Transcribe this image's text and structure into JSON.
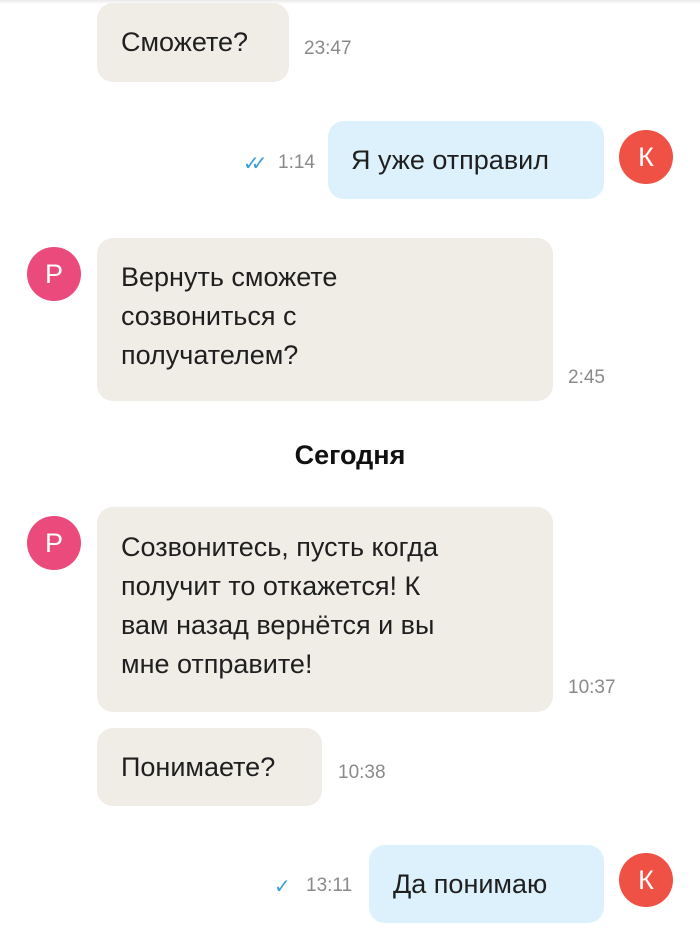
{
  "day_separator": "Сегодня",
  "colors": {
    "avatar_p": "#ea4b7c",
    "avatar_k": "#ef5145",
    "incoming_bubble": "#f0ede7",
    "outgoing_bubble": "#dcf1fc",
    "check": "#3a9fd8"
  },
  "messages": [
    {
      "direction": "incoming",
      "text": "Сможете?",
      "time": "23:47"
    },
    {
      "direction": "outgoing",
      "text": "Я уже отправил",
      "time": "1:14",
      "status_icon": "double-check-icon",
      "status_glyph": "✓✓",
      "avatar_letter": "К"
    },
    {
      "direction": "incoming",
      "text": "Вернуть сможете\nсозвониться с\nполучателем?",
      "time": "2:45",
      "avatar_letter": "Р"
    },
    {
      "direction": "incoming",
      "text": "Созвонитесь, пусть когда\nполучит то откажется! К\nвам назад вернётся и вы\nмне отправите!",
      "time": "10:37",
      "avatar_letter": "Р"
    },
    {
      "direction": "incoming",
      "text": "Понимаете?",
      "time": "10:38"
    },
    {
      "direction": "outgoing",
      "text": "Да понимаю",
      "time": "13:11",
      "status_icon": "single-check-icon",
      "status_glyph": "✓",
      "avatar_letter": "К"
    }
  ]
}
